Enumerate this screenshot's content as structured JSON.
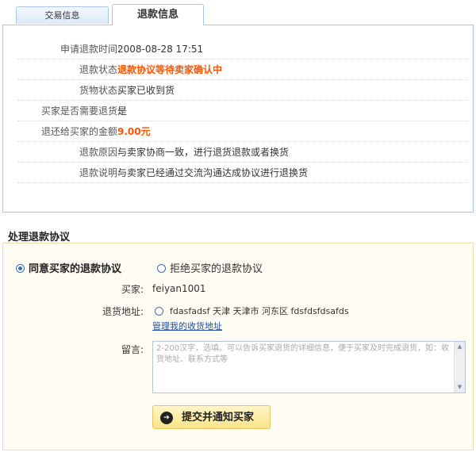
{
  "tabs": {
    "transaction_label": "交易信息",
    "refund_label": "退款信息"
  },
  "refund_info": {
    "rows": [
      {
        "label": "申请退款时间:",
        "value": "2008-08-28 17:51"
      },
      {
        "label": "退款状态:",
        "value": "退款协议等待卖家确认中"
      },
      {
        "label": "货物状态:",
        "value": "买家已收到货"
      },
      {
        "label": "买家是否需要退货:",
        "value": "是"
      },
      {
        "label": "退还给买家的金额:",
        "value": "9.00元"
      },
      {
        "label": "退款原因:",
        "value": "与卖家协商一致，进行退货退款或者换货"
      },
      {
        "label": "退款说明:",
        "value": "与卖家已经通过交流沟通达成协议进行退换货"
      }
    ]
  },
  "process": {
    "heading": "处理退款协议",
    "agree_label": "同意买家的退款协议",
    "refuse_label": "拒绝买家的退款协议",
    "selected": "agree",
    "buyer_label": "买家:",
    "buyer_value": "feiyan1001",
    "address_label": "退货地址:",
    "address_value": "fdasfadsf 天津 天津市 河东区 fdsfdsfdsafds",
    "manage_address_link": "管理我的收货地址",
    "message_label": "留言:",
    "message_placeholder": "2-200汉字，选填。可以告诉买家退货的详细信息，便于买家及时完成退货，如：收货地址、联系方式等",
    "submit_label": "提交并通知买家"
  },
  "colors": {
    "accent_orange": "#ff5500",
    "tab_border": "#a9c6e6",
    "process_bg": "#fffdf3",
    "button_bg": "#fde48a",
    "link_blue": "#1e4fa3"
  }
}
